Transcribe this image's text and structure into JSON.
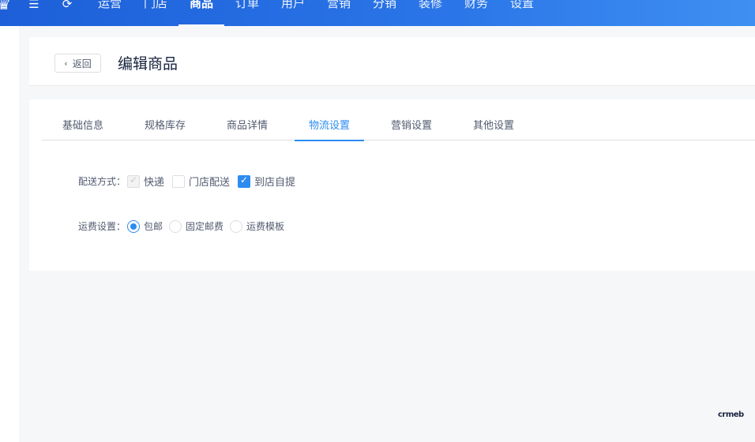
{
  "topbar": {
    "nav": [
      "运营",
      "门店",
      "商品",
      "订单",
      "用户",
      "营销",
      "分销",
      "装修",
      "财务",
      "设置"
    ],
    "active_index": 2,
    "icons": [
      "logo-icon",
      "menu-collapse-icon",
      "refresh-icon"
    ]
  },
  "header": {
    "back_label": "返回",
    "title": "编辑商品"
  },
  "tabs": [
    "基础信息",
    "规格库存",
    "商品详情",
    "物流设置",
    "营销设置",
    "其他设置"
  ],
  "active_tab": 3,
  "form": {
    "delivery_label": "配送方式：",
    "delivery_options": [
      {
        "label": "快递",
        "state": "disabled-checked"
      },
      {
        "label": "门店配送",
        "state": "unchecked"
      },
      {
        "label": "到店自提",
        "state": "checked"
      }
    ],
    "freight_label": "运费设置：",
    "freight_options": [
      {
        "label": "包邮",
        "selected": true
      },
      {
        "label": "固定邮费",
        "selected": false
      },
      {
        "label": "运费模板",
        "selected": false
      }
    ]
  },
  "watermark": "crmeb",
  "colors": {
    "primary": "#2d8cf0",
    "topbar": "#2a76e8"
  }
}
